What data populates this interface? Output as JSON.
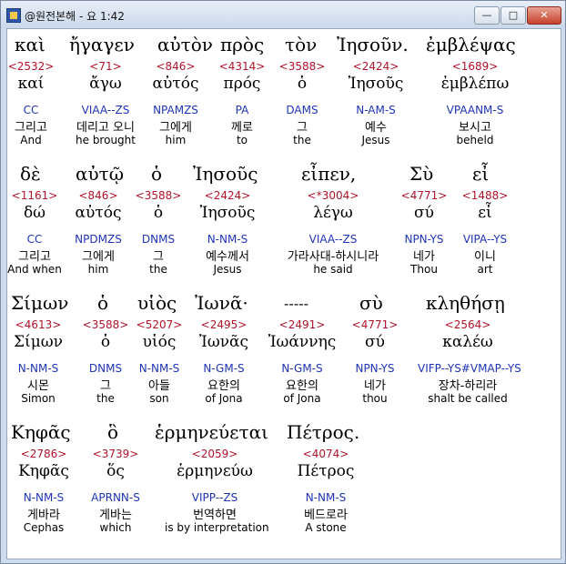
{
  "window": {
    "title": "@원전본해 - 요 1:42",
    "min_label": "—",
    "max_label": "□",
    "close_label": "✕"
  },
  "lines": [
    {
      "words": [
        {
          "greek": "καὶ",
          "strong": "<2532>",
          "lemma": "καί",
          "morph": "CC",
          "ko": "그리고",
          "en": "And"
        },
        {
          "greek": "ἤγαγεν",
          "strong": "<71>",
          "lemma": "ἄγω",
          "morph": "VIAA--ZS",
          "ko": "데리고 오니",
          "en": "he brought"
        },
        {
          "greek": "αὐτὸν",
          "strong": "<846>",
          "lemma": "αὐτός",
          "morph": "NPAMZS",
          "ko": "그에게",
          "en": "him"
        },
        {
          "greek": "πρὸς",
          "strong": "<4314>",
          "lemma": "πρός",
          "morph": "PA",
          "ko": "께로",
          "en": "to"
        },
        {
          "greek": "τὸν",
          "strong": "<3588>",
          "lemma": "ὁ",
          "morph": "DAMS",
          "ko": "그",
          "en": "the"
        },
        {
          "greek": "Ἰησοῦν.",
          "strong": "<2424>",
          "lemma": "Ἰησοῦς",
          "morph": "N-AM-S",
          "ko": "예수",
          "en": "Jesus"
        },
        {
          "greek": "ἐμβλέψας",
          "strong": "<1689>",
          "lemma": "ἐμβλέπω",
          "morph": "VPAANM-S",
          "ko": "보시고",
          "en": "beheld"
        }
      ]
    },
    {
      "words": [
        {
          "greek": "δὲ",
          "strong": "<1161>",
          "lemma": "δώ",
          "morph": "CC",
          "ko": "그리고",
          "en": "And when"
        },
        {
          "greek": "αὐτῷ",
          "strong": "<846>",
          "lemma": "αὐτός",
          "morph": "NPDMZS",
          "ko": "그에게",
          "en": "him"
        },
        {
          "greek": "ὁ",
          "strong": "<3588>",
          "lemma": "ὁ",
          "morph": "DNMS",
          "ko": "그",
          "en": "the"
        },
        {
          "greek": "Ἰησοῦς",
          "strong": "<2424>",
          "lemma": "Ἰησοῦς",
          "morph": "N-NM-S",
          "ko": "예수께서",
          "en": "Jesus"
        },
        {
          "greek": "εἶπεν,",
          "strong": "<*3004>",
          "lemma": "λέγω",
          "morph": "VIAA--ZS",
          "ko": "가라사대-하시니라",
          "en": "he said"
        },
        {
          "greek": "Σὺ",
          "strong": "<4771>",
          "lemma": "σύ",
          "morph": "NPN-YS",
          "ko": "네가",
          "en": "Thou"
        },
        {
          "greek": "εἶ",
          "strong": "<1488>",
          "lemma": "εἶ",
          "morph": "VIPA--YS",
          "ko": "이니",
          "en": "art"
        }
      ]
    },
    {
      "words": [
        {
          "greek": "Σίμων",
          "strong": "<4613>",
          "lemma": "Σίμων",
          "morph": "N-NM-S",
          "ko": "시몬",
          "en": "Simon"
        },
        {
          "greek": "ὁ",
          "strong": "<3588>",
          "lemma": "ὁ",
          "morph": "DNMS",
          "ko": "그",
          "en": "the"
        },
        {
          "greek": "υἱὸς",
          "strong": "<5207>",
          "lemma": "υἱός",
          "morph": "N-NM-S",
          "ko": "아들",
          "en": "son"
        },
        {
          "greek": "Ἰωνᾶ·",
          "strong": "<2495>",
          "lemma": "Ἰωνᾶς",
          "morph": "N-GM-S",
          "ko": "요한의",
          "en": "of Jona"
        },
        {
          "greek": "-----",
          "strong": "<2491>",
          "lemma": "Ἰωάννης",
          "morph": "N-GM-S",
          "ko": "요한의",
          "en": "of Jona"
        },
        {
          "greek": "σὺ",
          "strong": "<4771>",
          "lemma": "σύ",
          "morph": "NPN-YS",
          "ko": "네가",
          "en": "thou"
        },
        {
          "greek": "κληθήσῃ",
          "strong": "<2564>",
          "lemma": "καλέω",
          "morph": "VIFP--YS#VMAP--YS",
          "ko": "장차-하리라",
          "en": "shalt be called"
        }
      ]
    },
    {
      "words": [
        {
          "greek": "Κηφᾶς",
          "strong": "<2786>",
          "lemma": "Κηφᾶς",
          "morph": "N-NM-S",
          "ko": "게바라",
          "en": "Cephas"
        },
        {
          "greek": "ὃ",
          "strong": "<3739>",
          "lemma": "ὅς",
          "morph": "APRNN-S",
          "ko": "게바는",
          "en": "which"
        },
        {
          "greek": "ἑρμηνεύεται",
          "strong": "<2059>",
          "lemma": "ἑρμηνεύω",
          "morph": "VIPP--ZS",
          "ko": "번역하면",
          "en": "is by interpretation"
        },
        {
          "greek": "Πέτρος.",
          "strong": "<4074>",
          "lemma": "Πέτρος",
          "morph": "N-NM-S",
          "ko": "베드로라",
          "en": "A stone"
        }
      ]
    }
  ]
}
